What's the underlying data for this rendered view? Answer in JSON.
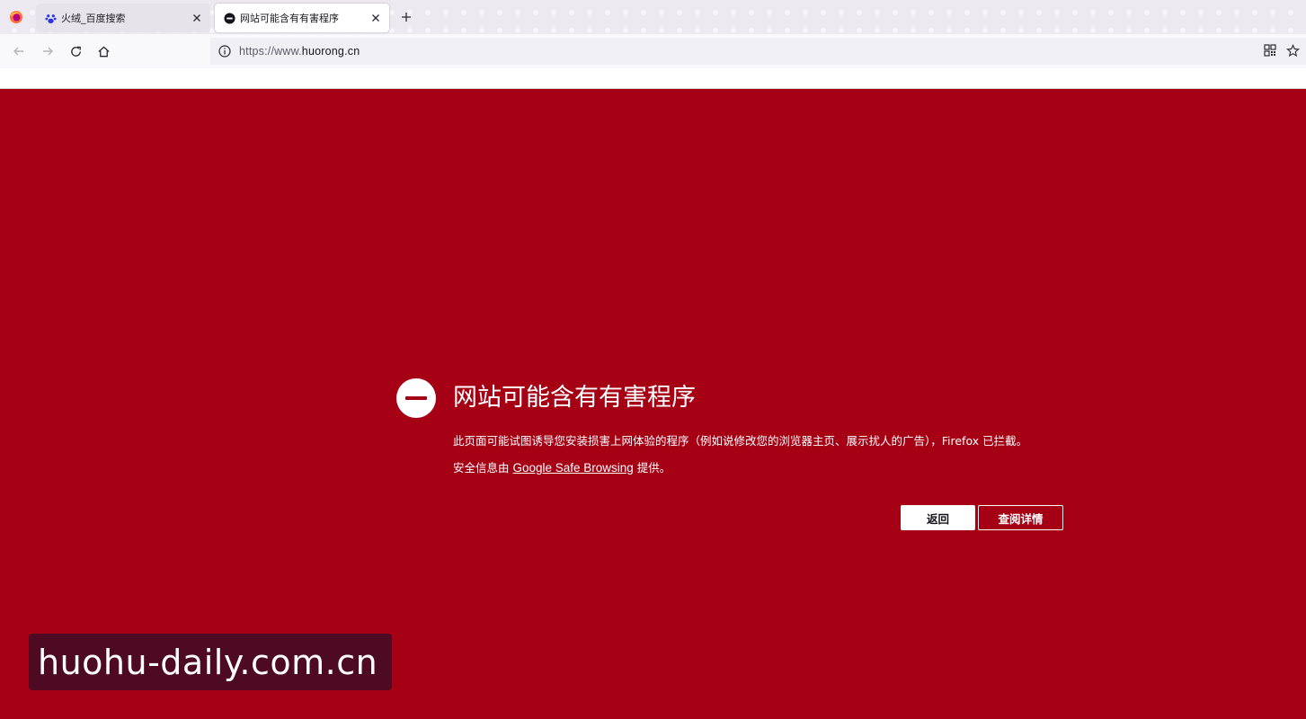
{
  "browser": {
    "tabs": [
      {
        "label": "火绒_百度搜索",
        "favicon": "baidu-paw-icon",
        "active": false
      },
      {
        "label": "网站可能含有有害程序",
        "favicon": "blocked-site-icon",
        "active": true
      }
    ],
    "url": {
      "prefix": "https://www.",
      "domain": "huorong.cn"
    }
  },
  "error_page": {
    "title": "网站可能含有有害程序",
    "description": "此页面可能试图诱导您安装损害上网体验的程序（例如说修改您的浏览器主页、展示扰人的广告），Firefox 已拦截。",
    "source_prefix": "安全信息由 ",
    "source_link": "Google Safe Browsing",
    "source_suffix": " 提供。",
    "back_button": "返回",
    "details_button": "查阅详情"
  },
  "watermark": {
    "text": "huohu-daily.com.cn"
  },
  "colors": {
    "page_background": "#a50014",
    "accent_white": "#ffffff",
    "watermark_background": "#4e0a22"
  }
}
